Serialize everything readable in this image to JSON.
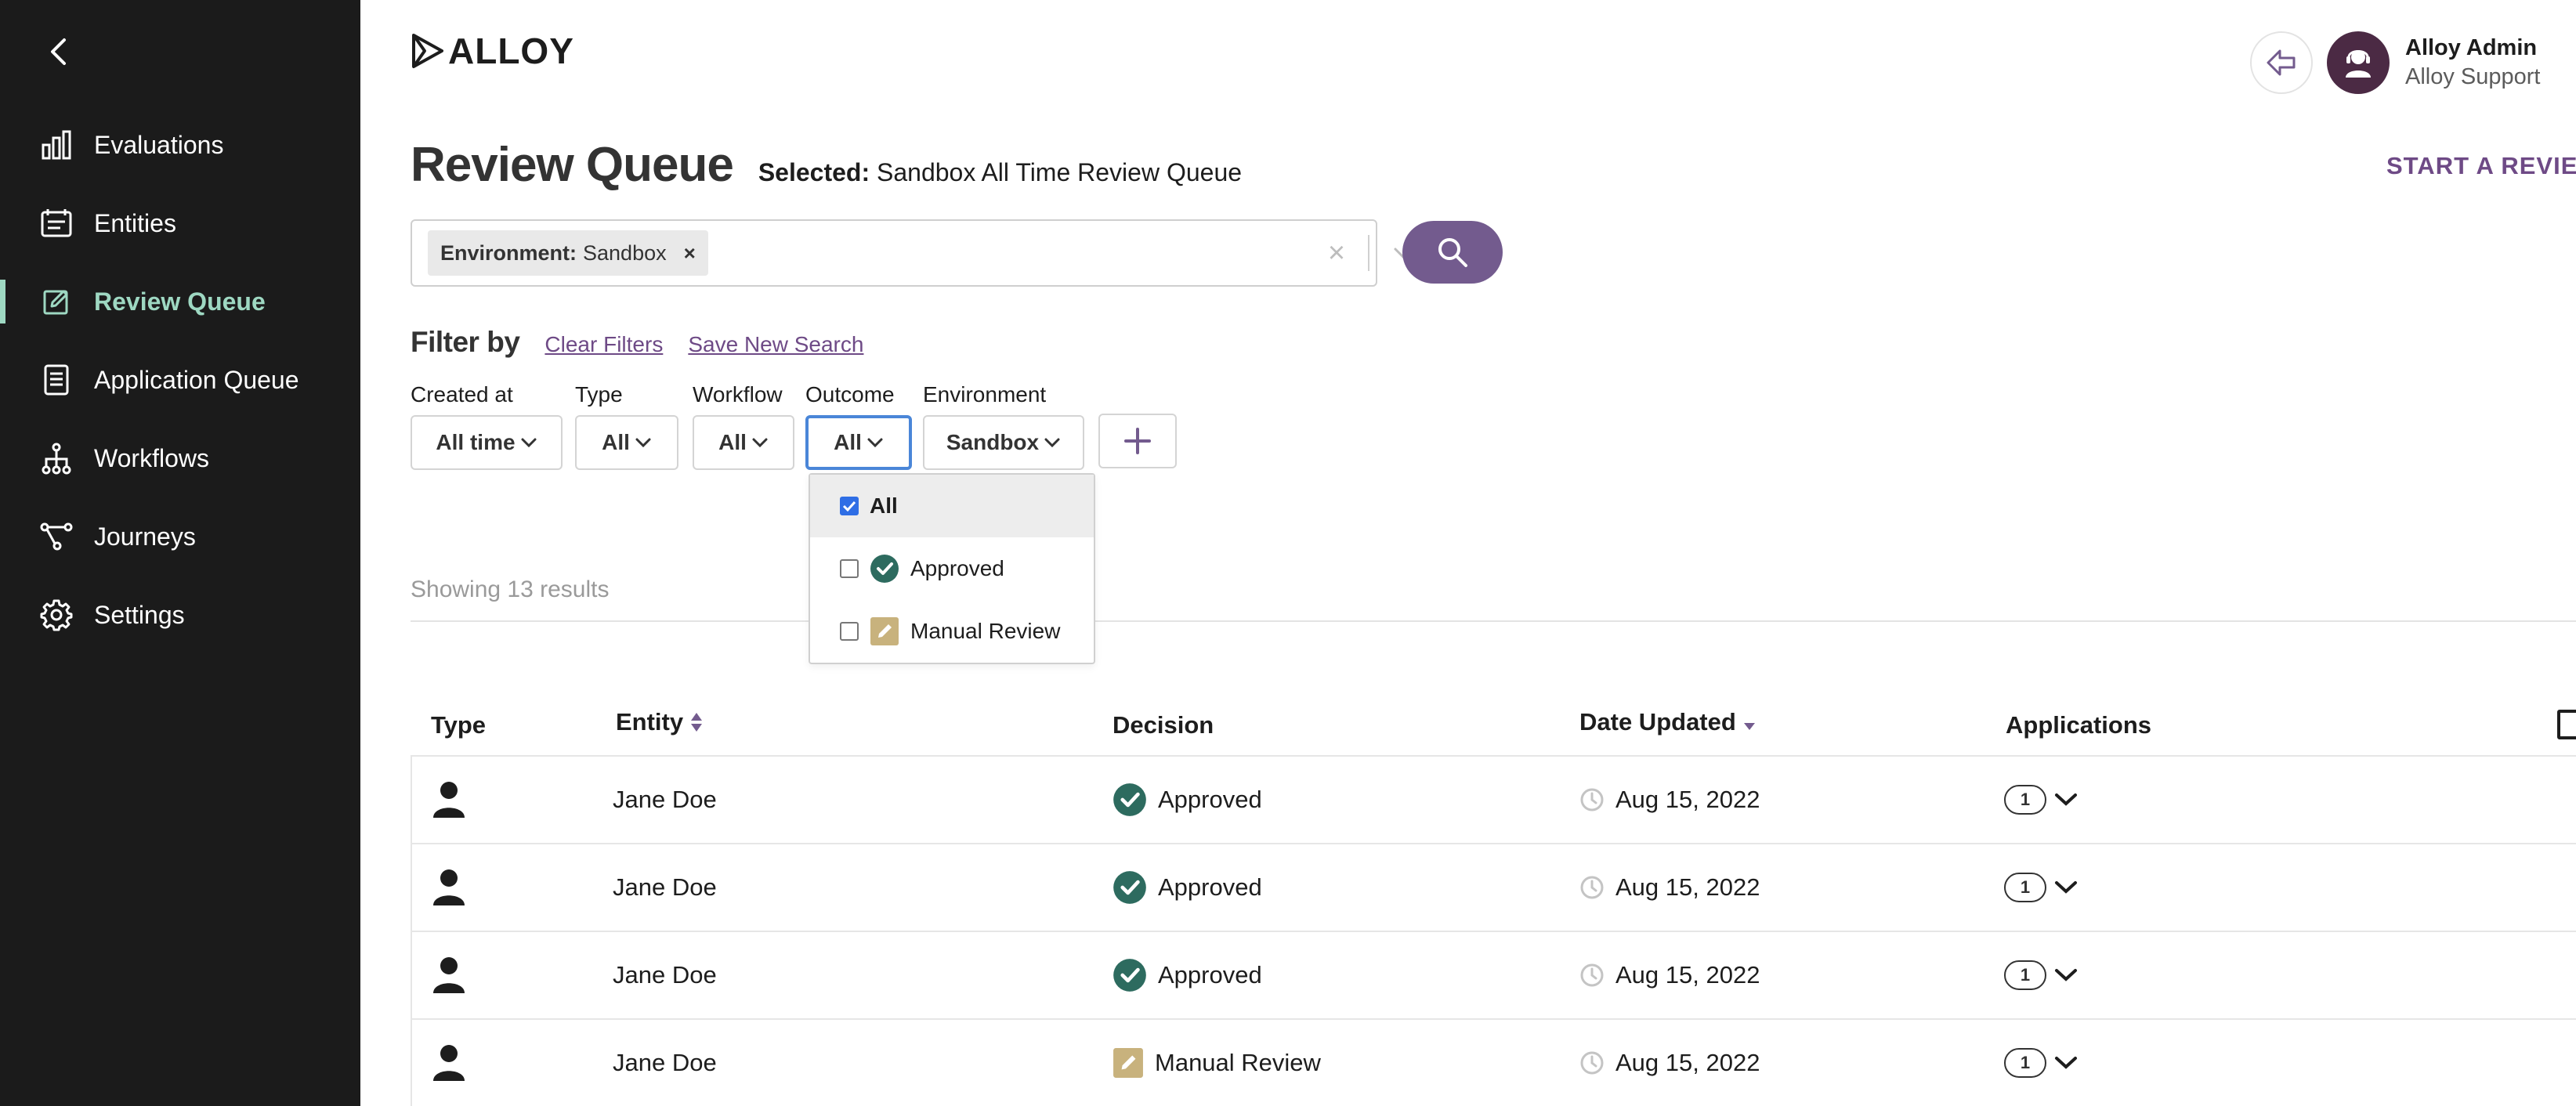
{
  "sidebar": {
    "items": [
      {
        "label": "Evaluations",
        "icon": "bar-chart-icon"
      },
      {
        "label": "Entities",
        "icon": "id-card-icon"
      },
      {
        "label": "Review Queue",
        "icon": "edit-icon",
        "active": true
      },
      {
        "label": "Application Queue",
        "icon": "document-icon"
      },
      {
        "label": "Workflows",
        "icon": "workflow-icon"
      },
      {
        "label": "Journeys",
        "icon": "journey-icon"
      },
      {
        "label": "Settings",
        "icon": "gear-icon"
      }
    ]
  },
  "header": {
    "logo_text": "ALLOY",
    "user_name": "Alloy Admin",
    "user_role": "Alloy Support"
  },
  "page": {
    "title": "Review Queue",
    "selected_label": "Selected:",
    "selected_value": "Sandbox All Time Review Queue",
    "start_review": "START A REVIEW"
  },
  "search": {
    "chip_key": "Environment:",
    "chip_value": "Sandbox",
    "chip_remove": "×",
    "clear": "×"
  },
  "filters": {
    "heading": "Filter by",
    "clear_link": "Clear Filters",
    "save_link": "Save New Search",
    "items": [
      {
        "label": "Created at",
        "value": "All time"
      },
      {
        "label": "Type",
        "value": "All"
      },
      {
        "label": "Workflow",
        "value": "All"
      },
      {
        "label": "Outcome",
        "value": "All"
      },
      {
        "label": "Environment",
        "value": "Sandbox"
      }
    ]
  },
  "outcome_dropdown": {
    "options": [
      {
        "label": "All",
        "checked": true
      },
      {
        "label": "Approved",
        "checked": false
      },
      {
        "label": "Manual Review",
        "checked": false
      }
    ]
  },
  "results": {
    "text": "Showing 13 results"
  },
  "table": {
    "columns": {
      "type": "Type",
      "entity": "Entity",
      "decision": "Decision",
      "date_updated": "Date Updated",
      "applications": "Applications"
    },
    "rows": [
      {
        "entity": "Jane Doe",
        "decision": "Approved",
        "date": "Aug 15, 2022",
        "apps": "1"
      },
      {
        "entity": "Jane Doe",
        "decision": "Approved",
        "date": "Aug 15, 2022",
        "apps": "1"
      },
      {
        "entity": "Jane Doe",
        "decision": "Approved",
        "date": "Aug 15, 2022",
        "apps": "1"
      },
      {
        "entity": "Jane Doe",
        "decision": "Manual Review",
        "date": "Aug 15, 2022",
        "apps": "1"
      }
    ]
  },
  "colors": {
    "sidebar_bg": "#1b1b1b",
    "active_nav": "#9ed8c2",
    "brand_purple": "#735b8e",
    "approved_green": "#2d6b5f",
    "manual_review_tan": "#c8b27d",
    "focus_blue": "#4a86d8"
  }
}
